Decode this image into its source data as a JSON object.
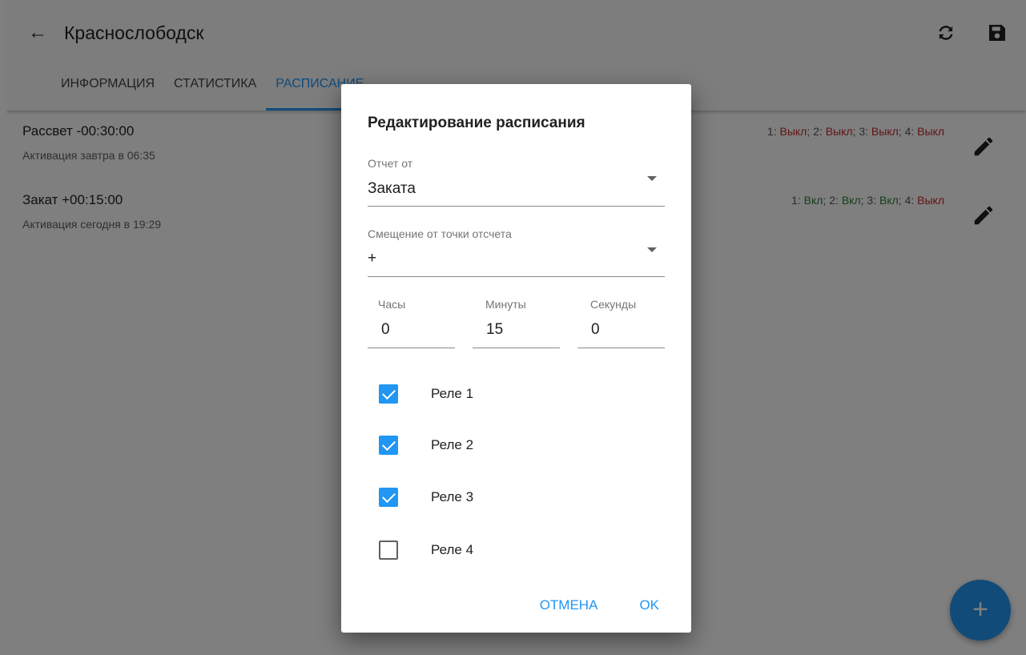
{
  "header": {
    "title": "Краснослободск",
    "back_icon": "arrow-left-icon",
    "refresh_icon": "refresh-icon",
    "save_icon": "save-icon"
  },
  "tabs": [
    {
      "label": "ИНФОРМАЦИЯ",
      "active": false
    },
    {
      "label": "СТАТИСТИКА",
      "active": false
    },
    {
      "label": "РАСПИСАНИЕ",
      "active": true
    }
  ],
  "schedules": [
    {
      "title": "Рассвет -00:30:00",
      "subtitle": "Активация завтра в 06:35",
      "relays": [
        {
          "prefix": "1: ",
          "state": "Выкл",
          "sep": "; "
        },
        {
          "prefix": "2: ",
          "state": "Выкл",
          "sep": "; "
        },
        {
          "prefix": "3: ",
          "state": "Выкл",
          "sep": "; "
        },
        {
          "prefix": "4: ",
          "state": "Выкл",
          "sep": ""
        }
      ]
    },
    {
      "title": "Закат +00:15:00",
      "subtitle": "Активация сегодня в 19:29",
      "relays": [
        {
          "prefix": "1: ",
          "state": "Вкл",
          "sep": "; "
        },
        {
          "prefix": "2: ",
          "state": "Вкл",
          "sep": "; "
        },
        {
          "prefix": "3: ",
          "state": "Вкл",
          "sep": "; "
        },
        {
          "prefix": "4: ",
          "state": "Выкл",
          "sep": ""
        }
      ]
    }
  ],
  "fab": {
    "label": "+"
  },
  "dialog": {
    "title": "Редактирование расписания",
    "reference": {
      "label": "Отчет от",
      "value": "Заката"
    },
    "offset": {
      "label": "Смещение от точки отсчета",
      "value": "+"
    },
    "hours": {
      "label": "Часы",
      "value": "0"
    },
    "minutes": {
      "label": "Минуты",
      "value": "15"
    },
    "seconds": {
      "label": "Секунды",
      "value": "0"
    },
    "relays": [
      {
        "label": "Реле 1",
        "checked": true
      },
      {
        "label": "Реле 2",
        "checked": true
      },
      {
        "label": "Реле 3",
        "checked": true
      },
      {
        "label": "Реле 4",
        "checked": false
      }
    ],
    "cancel_label": "ОТМЕНА",
    "ok_label": "OK"
  },
  "colors": {
    "accent": "#2196f3",
    "on": "#2e7d32",
    "off": "#c62828"
  }
}
